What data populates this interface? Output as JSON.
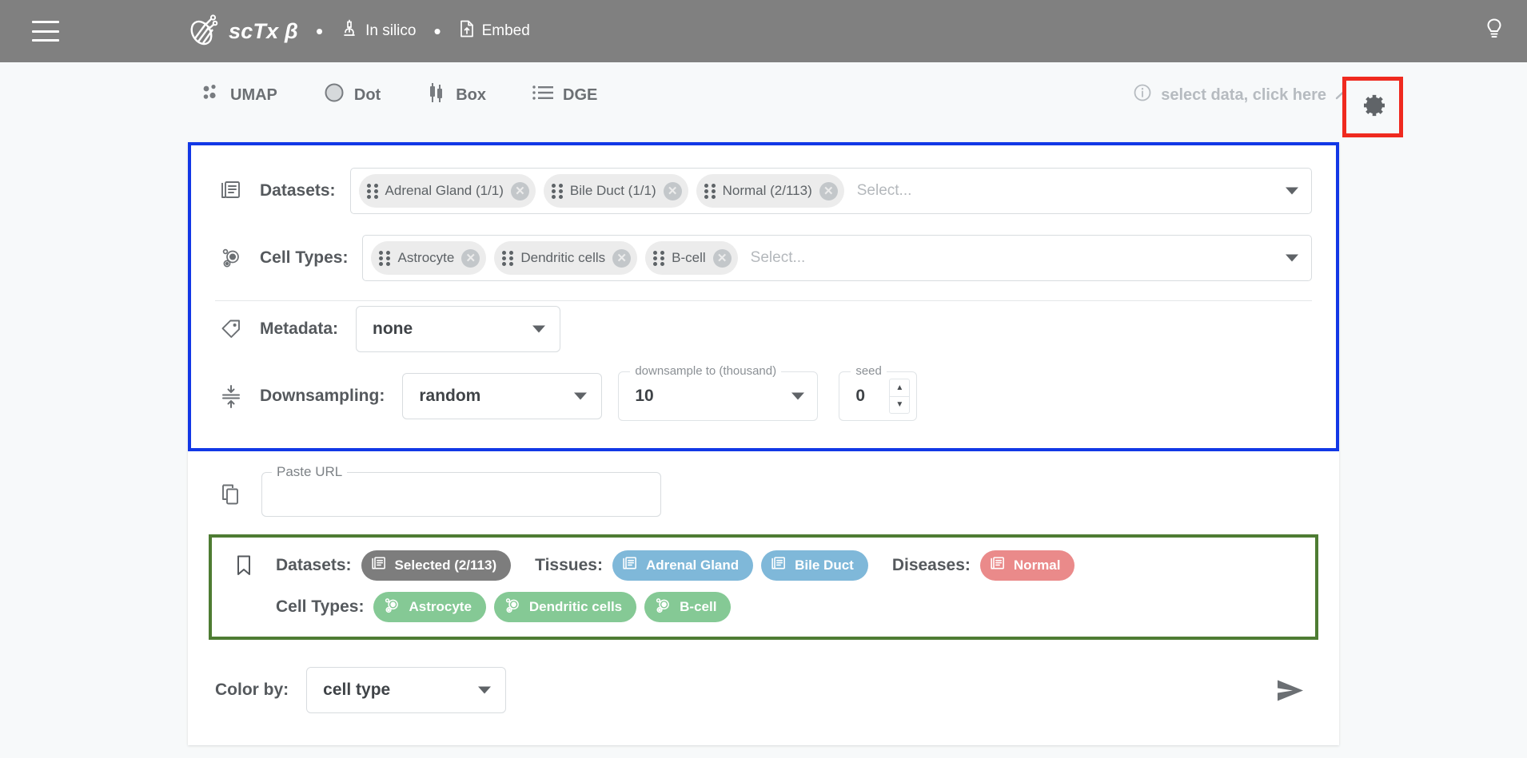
{
  "appbar": {
    "menu_icon": "hamburger-menu-icon",
    "logo_icon": "sctx-logo-icon",
    "title": "scTx β",
    "separator": "•",
    "nav": [
      {
        "icon": "microscope-icon",
        "label": "In silico"
      },
      {
        "icon": "embed-document-icon",
        "label": "Embed"
      }
    ],
    "help_icon": "lightbulb-icon"
  },
  "tabs": [
    {
      "icon": "umap-scatter-icon",
      "label": "UMAP"
    },
    {
      "icon": "dot-circle-icon",
      "label": "Dot"
    },
    {
      "icon": "boxplot-icon",
      "label": "Box"
    },
    {
      "icon": "list-lines-icon",
      "label": "DGE"
    }
  ],
  "hint": {
    "info_icon": "info-circle-icon",
    "text": "select data, click here",
    "arrow_icon": "arrow-turn-right-icon"
  },
  "settings": {
    "gear_icon": "gear-icon",
    "highlight_color": "#ef2a1f"
  },
  "selector_panel": {
    "border_color": "#1238e6",
    "datasets": {
      "icon": "library-books-icon",
      "label": "Datasets:",
      "placeholder": "Select...",
      "chips": [
        {
          "label": "Adrenal Gland  (1/1)"
        },
        {
          "label": "Bile Duct  (1/1)"
        },
        {
          "label": "Normal  (2/113)"
        }
      ]
    },
    "cell_types": {
      "icon": "cell-biotech-icon",
      "label": "Cell Types:",
      "placeholder": "Select...",
      "chips": [
        {
          "label": "Astrocyte"
        },
        {
          "label": "Dendritic cells"
        },
        {
          "label": "B-cell"
        }
      ]
    },
    "metadata": {
      "icon": "tag-icon",
      "label": "Metadata:",
      "value": "none"
    },
    "downsampling": {
      "icon": "downsample-icon",
      "label": "Downsampling:",
      "method_value": "random",
      "amount_legend": "downsample to (thousand)",
      "amount_value": "10",
      "seed_legend": "seed",
      "seed_value": "0"
    }
  },
  "url_section": {
    "icon": "copy-icon",
    "legend": "Paste URL",
    "value": ""
  },
  "summary": {
    "border_color": "#4e7c33",
    "icon": "bookmark-icon",
    "line1": {
      "datasets_label": "Datasets:",
      "datasets_pill": {
        "label": "Selected (2/113)",
        "color": "#7d7d7d",
        "icon": "library-books-icon"
      },
      "tissues_label": "Tissues:",
      "tissue_pills": [
        {
          "label": "Adrenal Gland",
          "color": "#7fb8d9",
          "icon": "library-books-icon"
        },
        {
          "label": "Bile Duct",
          "color": "#7fb8d9",
          "icon": "library-books-icon"
        }
      ],
      "diseases_label": "Diseases:",
      "disease_pills": [
        {
          "label": "Normal",
          "color": "#ea8a8a",
          "icon": "library-books-icon"
        }
      ]
    },
    "line2": {
      "cell_types_label": "Cell Types:",
      "cell_pills": [
        {
          "label": "Astrocyte",
          "color": "#85c995",
          "icon": "cell-biotech-icon"
        },
        {
          "label": "Dendritic cells",
          "color": "#85c995",
          "icon": "cell-biotech-icon"
        },
        {
          "label": "B-cell",
          "color": "#85c995",
          "icon": "cell-biotech-icon"
        }
      ]
    }
  },
  "color_by": {
    "label": "Color by:",
    "value": "cell type",
    "submit_icon": "send-icon"
  }
}
